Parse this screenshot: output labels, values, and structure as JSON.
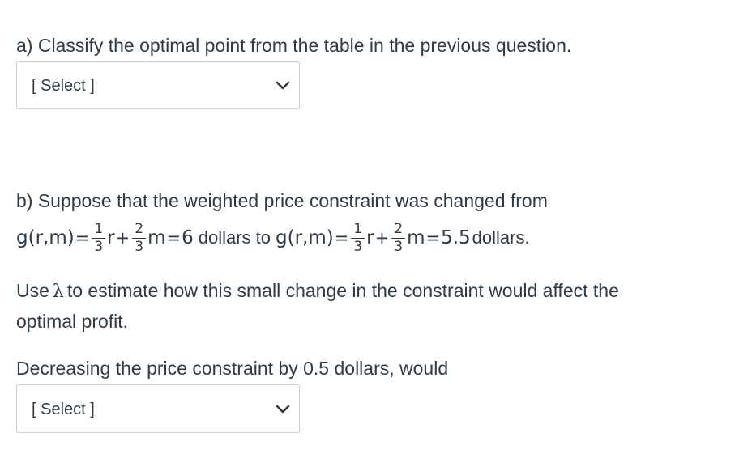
{
  "part_a": {
    "question": "a) Classify the optimal point from the table in the previous question.",
    "select_label": "[ Select ]",
    "chevron_icon": "chevron-down-icon"
  },
  "part_b": {
    "line1": "b) Suppose that the weighted price constraint was changed from",
    "eq1": {
      "lhs": "g(r,m)",
      "eq": "=",
      "frac1_num": "1",
      "frac1_den": "3",
      "var1": "r",
      "plus": "+",
      "frac2_num": "2",
      "frac2_den": "3",
      "var2": "m",
      "eq2": "=",
      "rhs": "6"
    },
    "mid_text": "dollars to",
    "eq2": {
      "lhs": "g(r,m)",
      "eq": "=",
      "frac1_num": "1",
      "frac1_den": "3",
      "var1": "r",
      "plus": "+",
      "frac2_num": "2",
      "frac2_den": "3",
      "var2": "m",
      "eq2": "=",
      "rhs": "5.5"
    },
    "end_text": "dollars.",
    "use_prefix": "Use",
    "lambda_symbol": "λ",
    "use_suffix": "to estimate how this small change in the constraint would affect the",
    "use_line2": "optimal profit.",
    "decreasing_text": "Decreasing the price constraint by 0.5 dollars, would",
    "select_label": "[ Select ]",
    "chevron_icon": "chevron-down-icon"
  },
  "colors": {
    "text": "#2d3b45",
    "border": "#c7cdd1"
  }
}
